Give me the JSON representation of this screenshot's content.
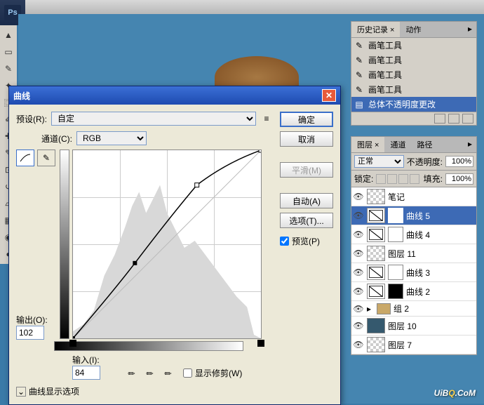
{
  "app": {
    "logo": "Ps"
  },
  "history_panel": {
    "tabs": {
      "history": "历史记录 ×",
      "actions": "动作"
    },
    "items": [
      {
        "icon": "brush",
        "label": "画笔工具"
      },
      {
        "icon": "brush",
        "label": "画笔工具"
      },
      {
        "icon": "brush",
        "label": "画笔工具"
      },
      {
        "icon": "brush",
        "label": "画笔工具"
      },
      {
        "icon": "opacity",
        "label": "总体不透明度更改",
        "selected": true
      }
    ]
  },
  "layers_panel": {
    "tabs": {
      "layers": "图层 ×",
      "channels": "通道",
      "paths": "路径"
    },
    "blend_mode": "正常",
    "opacity_label": "不透明度:",
    "opacity": "100%",
    "lock_label": "锁定:",
    "fill_label": "填充:",
    "fill": "100%",
    "layers": [
      {
        "type": "text",
        "name": "笔记",
        "thumb": "checker"
      },
      {
        "type": "adj",
        "name": "曲线 5",
        "thumb": "curves",
        "mask": true,
        "selected": true
      },
      {
        "type": "adj",
        "name": "曲线 4",
        "thumb": "curves",
        "mask": true
      },
      {
        "type": "normal",
        "name": "图层 11",
        "thumb": "checker"
      },
      {
        "type": "adj",
        "name": "曲线 3",
        "thumb": "curves",
        "mask": true
      },
      {
        "type": "adj",
        "name": "曲线 2",
        "thumb": "curves",
        "mask_dark": true
      },
      {
        "type": "group",
        "name": "组 2"
      },
      {
        "type": "normal",
        "name": "图层 10",
        "thumb": "image"
      },
      {
        "type": "normal",
        "name": "图层 7",
        "thumb": "checker"
      }
    ]
  },
  "curves_dialog": {
    "title": "曲线",
    "preset_label": "预设(R):",
    "preset_value": "自定",
    "channel_label": "通道(C):",
    "channel_value": "RGB",
    "buttons": {
      "ok": "确定",
      "cancel": "取消",
      "smooth": "平滑(M)",
      "auto": "自动(A)",
      "options": "选项(T)..."
    },
    "preview_label": "预览(P)",
    "preview_checked": true,
    "output_label": "输出(O):",
    "output_value": "102",
    "input_label": "输入(I):",
    "input_value": "84",
    "show_clipping_label": "显示修剪(W)",
    "show_clipping_checked": false,
    "curve_options_label": "曲线显示选项"
  },
  "chart_data": {
    "type": "line",
    "title": "曲线",
    "xlabel": "输入",
    "ylabel": "输出",
    "xlim": [
      0,
      255
    ],
    "ylim": [
      0,
      255
    ],
    "series": [
      {
        "name": "RGB",
        "points": [
          {
            "x": 0,
            "y": 0
          },
          {
            "x": 84,
            "y": 102
          },
          {
            "x": 168,
            "y": 208
          },
          {
            "x": 255,
            "y": 255
          }
        ]
      }
    ],
    "baseline": [
      {
        "x": 0,
        "y": 0
      },
      {
        "x": 255,
        "y": 255
      }
    ],
    "grid": true
  },
  "watermark": {
    "pre": "UiB",
    "mid": "Q",
    "post": ".CoM"
  }
}
